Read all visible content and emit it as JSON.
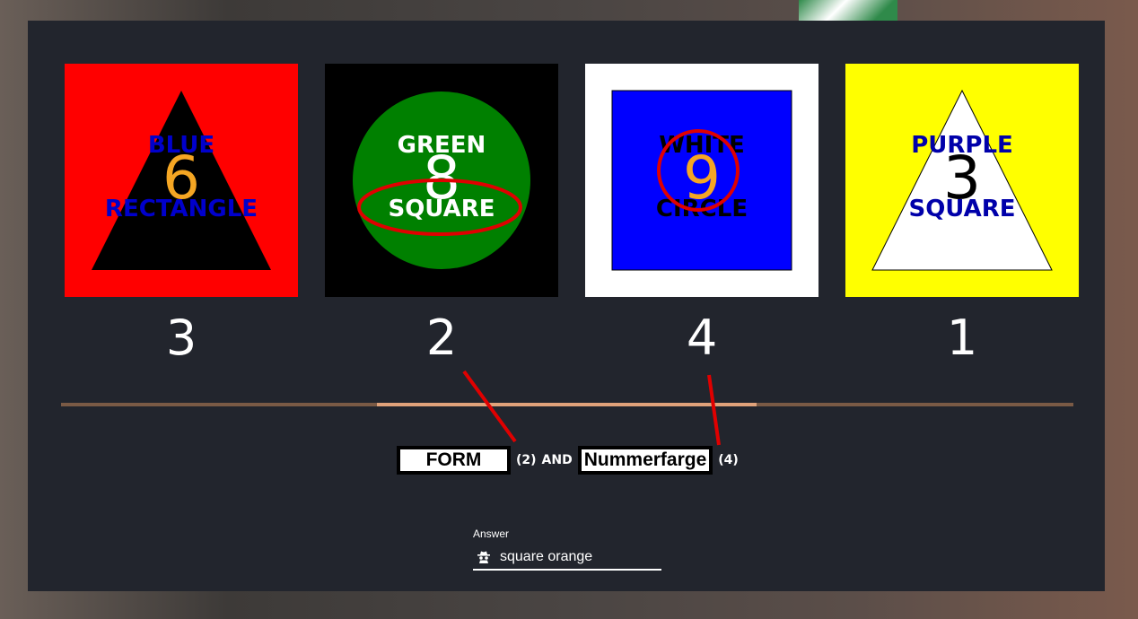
{
  "cards": [
    {
      "shape": "triangle",
      "bg_color": "#ff0000",
      "shape_color": "#000000",
      "word1": "BLUE",
      "word2": "RECTANGLE",
      "word_color": "#0000cc",
      "number": "6",
      "number_color": "#f5a623",
      "ordinal": "3"
    },
    {
      "shape": "circle",
      "bg_color": "#000000",
      "shape_color": "#008000",
      "word1": "GREEN",
      "word2": "SQUARE",
      "word_color": "#ffffff",
      "number": "8",
      "number_color": "#ffffff",
      "ordinal": "2"
    },
    {
      "shape": "square",
      "bg_color": "#ffffff",
      "shape_color": "#0000ff",
      "word1": "WHITE",
      "word2": "CIRCLE",
      "word_color": "#000000",
      "number": "9",
      "number_color": "#f5a623",
      "ordinal": "4"
    },
    {
      "shape": "triangle",
      "bg_color": "#ffff00",
      "shape_color": "#ffffff",
      "word1": "PURPLE",
      "word2": "SQUARE",
      "word_color": "#0000aa",
      "number": "3",
      "number_color": "#000000",
      "ordinal": "1"
    }
  ],
  "progress": {
    "start_fraction": 0.31,
    "end_fraction": 0.69
  },
  "question": {
    "term1": "FORM",
    "ref1": "(2)",
    "conjunction": "AND",
    "term2": "Nummerfarge",
    "ref2": "(4)"
  },
  "answer": {
    "label": "Answer",
    "value": "square orange",
    "icon": "spy-icon"
  },
  "annotation_color": "#e00000"
}
